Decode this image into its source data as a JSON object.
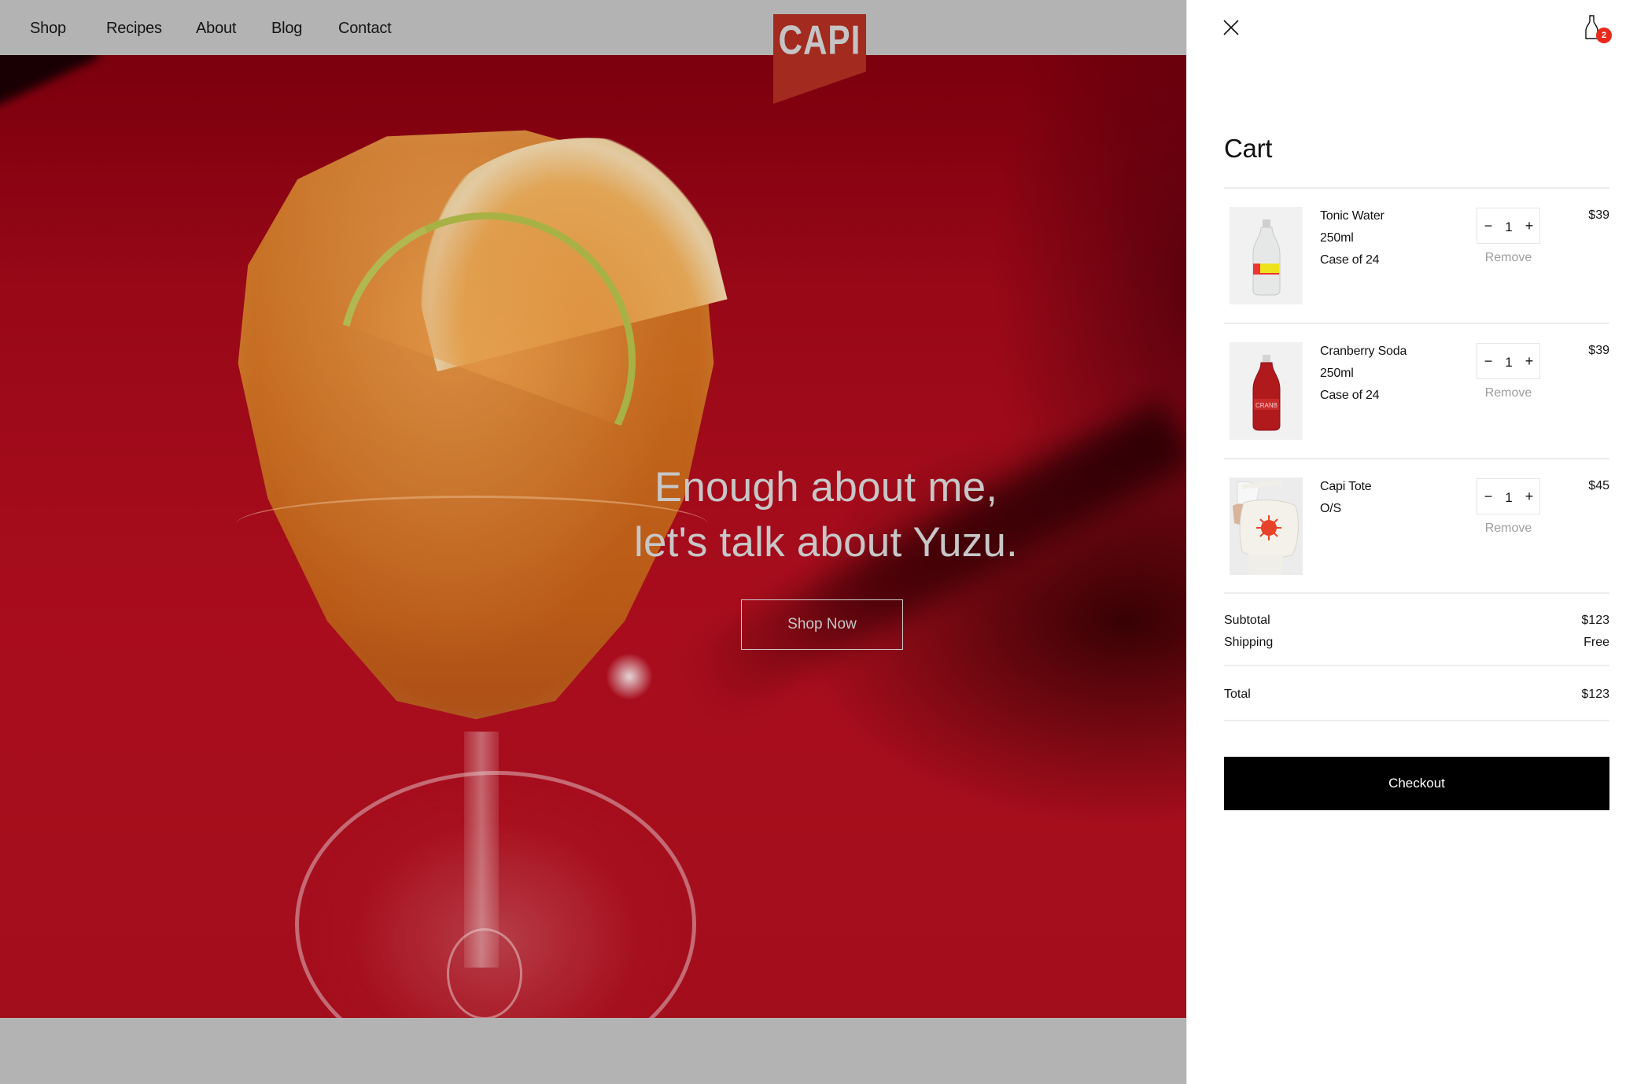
{
  "nav": {
    "links": [
      "Shop",
      "Recipes",
      "About",
      "Blog",
      "Contact"
    ],
    "logo_text": "CAPI"
  },
  "hero": {
    "headline_line1": "Enough about me,",
    "headline_line2": "let's talk about Yuzu.",
    "cta_label": "Shop Now"
  },
  "cart": {
    "title": "Cart",
    "badge_count": "2",
    "items": [
      {
        "name": "Tonic Water",
        "meta": [
          "250ml",
          "Case of 24"
        ],
        "quantity": "1",
        "remove_label": "Remove",
        "price": "$39",
        "thumb_icon": "tonic-water-bottle-image"
      },
      {
        "name": "Cranberry Soda",
        "meta": [
          "250ml",
          "Case of 24"
        ],
        "quantity": "1",
        "remove_label": "Remove",
        "price": "$39",
        "thumb_icon": "cranberry-soda-bottle-image"
      },
      {
        "name": "Capi Tote",
        "meta": [
          "O/S"
        ],
        "quantity": "1",
        "remove_label": "Remove",
        "price": "$45",
        "thumb_icon": "tote-bag-image"
      }
    ],
    "minus_symbol": "−",
    "plus_symbol": "+",
    "subtotal_label": "Subtotal",
    "subtotal_value": "$123",
    "shipping_label": "Shipping",
    "shipping_value": "Free",
    "total_label": "Total",
    "total_value": "$123",
    "checkout_label": "Checkout"
  },
  "colors": {
    "brand_red": "#c0281c",
    "badge_red": "#e8291c",
    "overlay_gray": "#b3b3b3",
    "checkout_black": "#000000"
  }
}
